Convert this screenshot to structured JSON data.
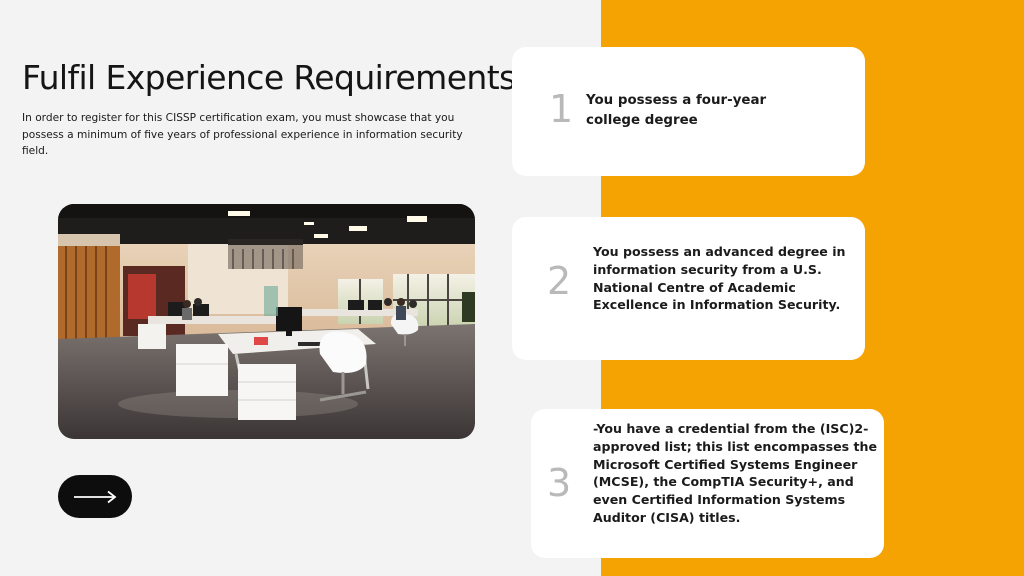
{
  "heading": {
    "title": "Fulfil Experience Requirements",
    "intro": "In order to register for this CISSP certification exam, you must showcase that you possess a minimum of five years of professional experience in information security field."
  },
  "image": {
    "subject": "open-plan office interior with desks, chairs and computers"
  },
  "navigation": {
    "next_icon": "arrow-right-icon"
  },
  "requirements": [
    {
      "number": "1",
      "text": "You possess a four-year college degree"
    },
    {
      "number": "2",
      "text": "You possess an advanced degree in information security from a U.S. National Centre of Academic Excellence in Information Security."
    },
    {
      "number": "3",
      "text": "-You have a credential from the (ISC)2-approved list; this list encompasses the Microsoft Certified Systems Engineer (MCSE), the CompTIA Security+, and even Certified Information Systems Auditor (CISA) titles."
    }
  ],
  "colors": {
    "accent": "#f5a302",
    "background": "#f3f3f3",
    "card": "#ffffff",
    "button": "#0d0d0d",
    "number": "#b9b9b9"
  }
}
